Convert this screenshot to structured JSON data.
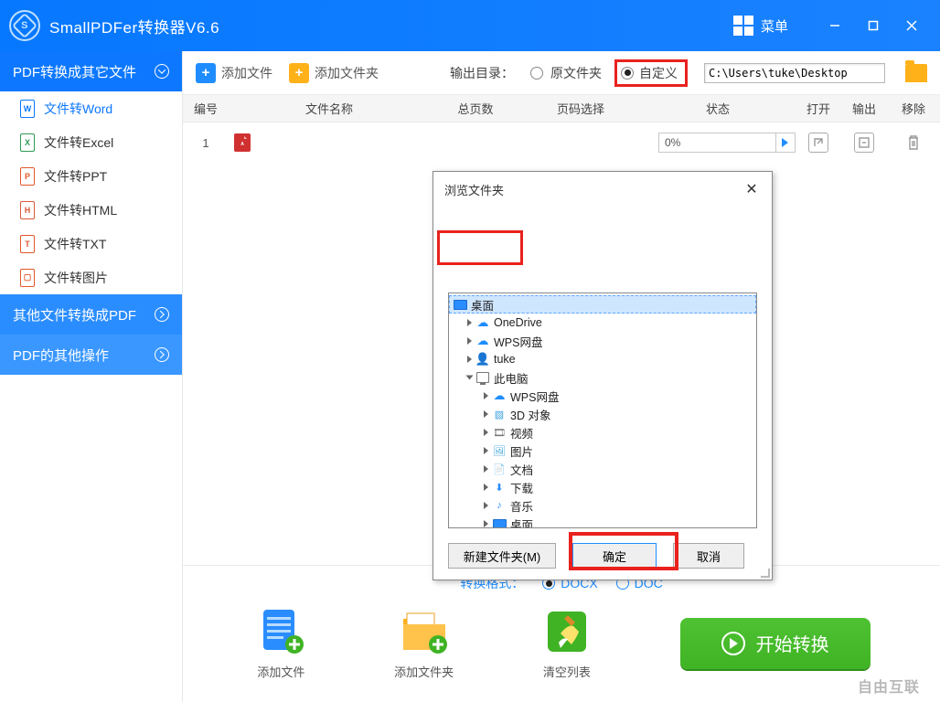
{
  "titlebar": {
    "app_title": "SmallPDFer转换器V6.6",
    "menu_label": "菜单"
  },
  "sidebar": {
    "header1": "PDF转换成其它文件",
    "items": [
      {
        "label": "文件转Word",
        "icon": "W"
      },
      {
        "label": "文件转Excel",
        "icon": "X"
      },
      {
        "label": "文件转PPT",
        "icon": "P"
      },
      {
        "label": "文件转HTML",
        "icon": "H"
      },
      {
        "label": "文件转TXT",
        "icon": "T"
      },
      {
        "label": "文件转图片",
        "icon": "▢"
      }
    ],
    "header2": "其他文件转换成PDF",
    "header3": "PDF的其他操作"
  },
  "toolbar": {
    "add_file": "添加文件",
    "add_folder": "添加文件夹",
    "output_label": "输出目录：",
    "opt_source": "原文件夹",
    "opt_custom": "自定义",
    "path_value": "C:\\Users\\tuke\\Desktop"
  },
  "table": {
    "headers": {
      "idx": "编号",
      "name": "文件名称",
      "pages": "总页数",
      "sel": "页码选择",
      "status": "状态",
      "open": "打开",
      "out": "输出",
      "del": "移除"
    },
    "rows": [
      {
        "idx": "1",
        "progress": "0%"
      }
    ]
  },
  "format": {
    "label": "转换格式：",
    "opt_docx": "DOCX",
    "opt_doc": "DOC"
  },
  "bottom": {
    "add_file": "添加文件",
    "add_folder": "添加文件夹",
    "clear": "清空列表",
    "start": "开始转换",
    "watermark": "自由互联"
  },
  "dialog": {
    "title": "浏览文件夹",
    "root": "桌面",
    "tree": [
      {
        "label": "OneDrive",
        "indent": 1,
        "icon": "cloud-blue"
      },
      {
        "label": "WPS网盘",
        "indent": 1,
        "icon": "cloud-blue"
      },
      {
        "label": "tuke",
        "indent": 1,
        "icon": "user"
      },
      {
        "label": "此电脑",
        "indent": 1,
        "icon": "pc",
        "expanded": true
      },
      {
        "label": "WPS网盘",
        "indent": 2,
        "icon": "cloud-blue"
      },
      {
        "label": "3D 对象",
        "indent": 2,
        "icon": "3d"
      },
      {
        "label": "视频",
        "indent": 2,
        "icon": "video"
      },
      {
        "label": "图片",
        "indent": 2,
        "icon": "image"
      },
      {
        "label": "文档",
        "indent": 2,
        "icon": "doc"
      },
      {
        "label": "下载",
        "indent": 2,
        "icon": "download"
      },
      {
        "label": "音乐",
        "indent": 2,
        "icon": "music"
      },
      {
        "label": "桌面",
        "indent": 2,
        "icon": "desktop"
      }
    ],
    "btn_new": "新建文件夹(M)",
    "btn_ok": "确定",
    "btn_cancel": "取消"
  }
}
